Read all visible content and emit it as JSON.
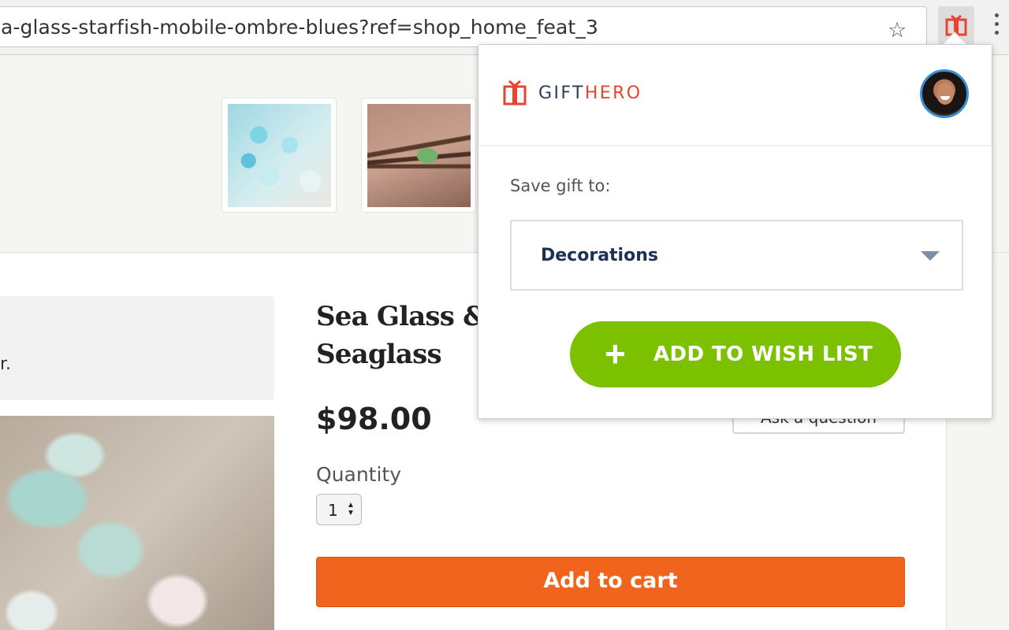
{
  "browser": {
    "url": "a-glass-starfish-mobile-ombre-blues?ref=shop_home_feat_3",
    "bookmark_icon": "star-icon",
    "extension_icon": "gift-icon",
    "menu_icon": "more-vert-icon"
  },
  "page": {
    "notice_text": "r.",
    "title_line1": "Sea Glass & S",
    "title_line2": "Seaglass",
    "price": "$98.00",
    "ask_button": "Ask a question",
    "quantity_label": "Quantity",
    "quantity_value": "1",
    "add_to_cart": "Add to cart",
    "cart_color": "#f1641e"
  },
  "popup": {
    "brand_part1": "GIFT",
    "brand_part2": "HERO",
    "save_label": "Save gift to:",
    "list_selected": "Decorations",
    "wish_button": "ADD TO WISH LIST",
    "wish_color": "#7bc100",
    "brand_red": "#e8442d",
    "brand_navy": "#2b3e5c"
  }
}
